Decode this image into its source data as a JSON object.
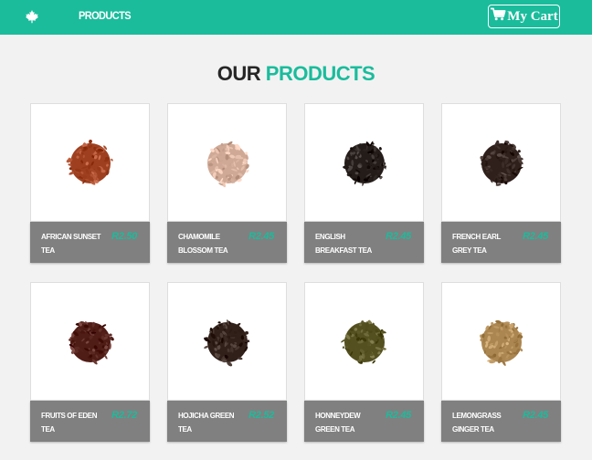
{
  "nav": {
    "logo_icon": "maple-leaf-icon",
    "link_label": "PRODUCTS",
    "cart_icon": "shopping-cart-icon",
    "cart_label": "My Cart"
  },
  "page_title": {
    "part1": "OUR",
    "part2": "PRODUCTS"
  },
  "colors": {
    "accent": "#1abc9c",
    "bar": "#808080",
    "background": "#f2f2f2"
  },
  "products": [
    {
      "name": "AFRICAN SUNSET TEA",
      "price": "R2.50",
      "color": "#a84a2a"
    },
    {
      "name": "CHAMOMILE BLOSSOM TEA",
      "price": "R2.45",
      "color": "#d9b3a0"
    },
    {
      "name": "ENGLISH BREAKFAST TEA",
      "price": "R2.45",
      "color": "#2e2623"
    },
    {
      "name": "FRENCH EARL GREY TEA",
      "price": "R2.45",
      "color": "#3a2a26"
    },
    {
      "name": "FRUITS OF EDEN TEA",
      "price": "R2.72",
      "color": "#5a2620"
    },
    {
      "name": "HOJICHA GREEN TEA",
      "price": "R2.52",
      "color": "#3b2a24"
    },
    {
      "name": "HONNEYDEW GREEN TEA",
      "price": "R2.45",
      "color": "#5e5a2a"
    },
    {
      "name": "LEMONGRASS GINGER TEA",
      "price": "R2.45",
      "color": "#b5905a"
    }
  ]
}
